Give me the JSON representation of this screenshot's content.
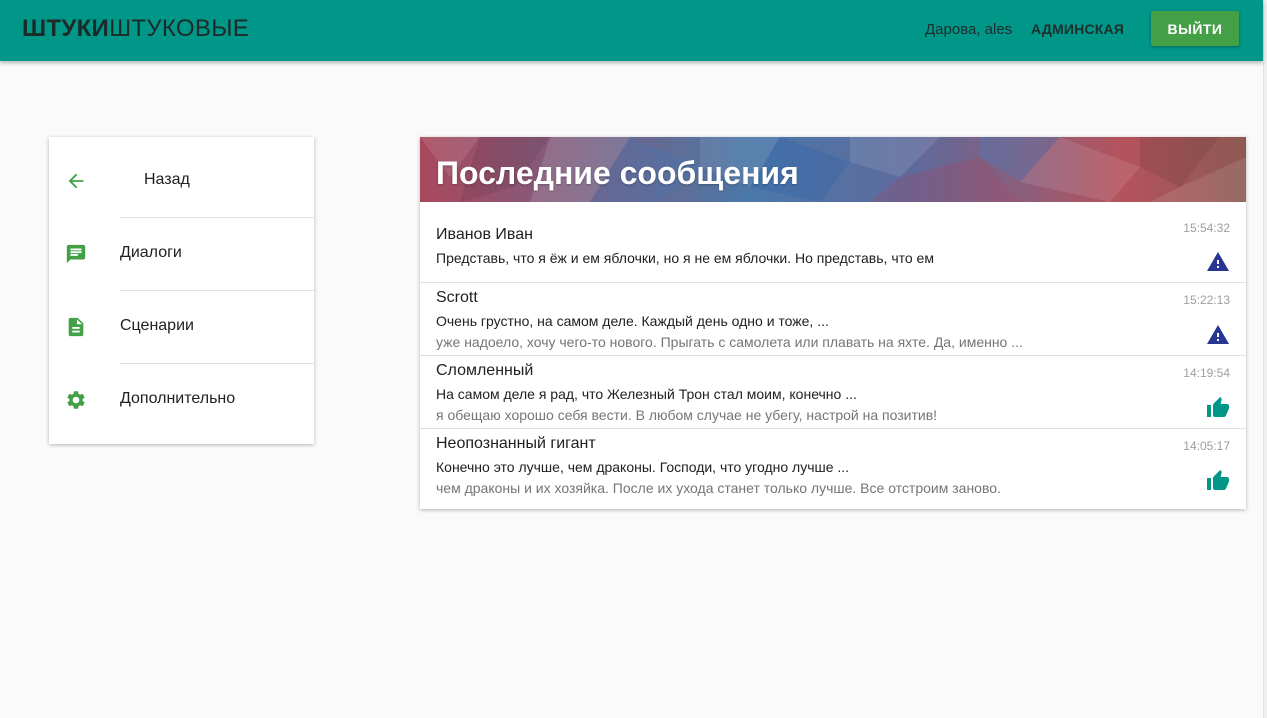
{
  "header": {
    "brand_bold": "ШТУКИ",
    "brand_light": "ШТУКОВЫЕ",
    "greeting": "Дарова, ales",
    "admin_link": "АДМИНСКАЯ",
    "logout_button": "ВЫЙТИ",
    "bar_color": "#009688",
    "button_color": "#43a047"
  },
  "sidebar": {
    "items": [
      {
        "label": "Назад",
        "icon": "arrow-back-icon"
      },
      {
        "label": "Диалоги",
        "icon": "chat-icon"
      },
      {
        "label": "Сценарии",
        "icon": "document-icon"
      },
      {
        "label": "Дополнительно",
        "icon": "gear-icon"
      }
    ],
    "icon_color": "#43a047"
  },
  "messages_card": {
    "title": "Последние сообщения",
    "messages": [
      {
        "author": "Иванов Иван",
        "line1": "Представь, что я ёж и ем яблочки, но я не ем яблочки. Но представь, что ем",
        "line2": "",
        "time": "15:54:32",
        "status": "warning-icon"
      },
      {
        "author": "Scrott",
        "line1": "Очень грустно, на самом деле. Каждый день одно и тоже, ...",
        "line2": "уже надоело, хочу чего-то нового. Прыгать с самолета или плавать на яхте. Да, именно ...",
        "time": "15:22:13",
        "status": "warning-icon"
      },
      {
        "author": "Сломленный",
        "line1": "На самом деле я рад, что Железный Трон стал моим, конечно ...",
        "line2": "я обещаю хорошо себя вести. В любом случае не убегу, настрой на позитив!",
        "time": "14:19:54",
        "status": "thumb-up-icon"
      },
      {
        "author": "Неопознанный гигант",
        "line1": "Конечно это лучше, чем драконы. Господи, что угодно лучше ...",
        "line2": "чем драконы и их хозяйка. После их ухода станет только лучше. Все отстроим заново.",
        "time": "14:05:17",
        "status": "thumb-up-icon"
      }
    ],
    "warning_color": "#283593",
    "like_color": "#009688"
  }
}
